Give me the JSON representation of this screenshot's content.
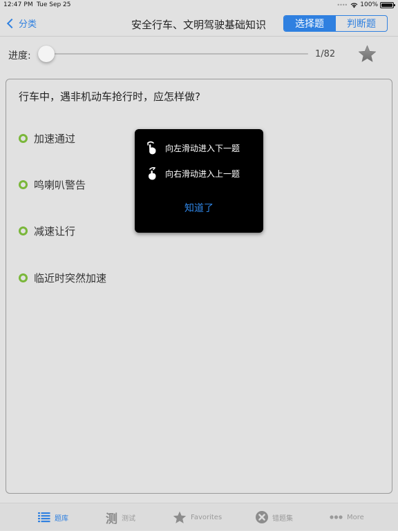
{
  "status_bar": {
    "time": "12:47 PM",
    "date": "Tue Sep 25",
    "battery": "100%",
    "wifi_icon": "wifi-icon",
    "battery_icon": "battery-icon"
  },
  "nav": {
    "back_label": "分类",
    "title": "安全行车、文明驾驶基础知识",
    "segments": [
      {
        "label": "选择题",
        "active": true
      },
      {
        "label": "判断题",
        "active": false
      }
    ],
    "accent": "#2f80e0"
  },
  "progress": {
    "label": "进度:",
    "current": 1,
    "total": 82,
    "count_text": "1/82",
    "slider_fraction": 0.0,
    "favorite_icon": "star-icon"
  },
  "question": {
    "text": "行车中，遇非机动车抢行时，应怎样做?",
    "options": [
      {
        "text": "加速通过"
      },
      {
        "text": "鸣喇叭警告"
      },
      {
        "text": "减速让行"
      },
      {
        "text": "临近时突然加速"
      }
    ],
    "radio_color": "#7ab73a"
  },
  "popup": {
    "hints": [
      {
        "icon": "swipe-left-hand-icon",
        "text": "向左滑动进入下一题"
      },
      {
        "icon": "swipe-right-hand-icon",
        "text": "向右滑动进入上一题"
      }
    ],
    "ok_label": "知道了"
  },
  "tab_bar": {
    "tabs": [
      {
        "label": "题库",
        "icon": "list-icon",
        "active": true
      },
      {
        "label": "测试",
        "icon": "test-icon",
        "active": false
      },
      {
        "label": "Favorites",
        "icon": "star-icon",
        "active": false
      },
      {
        "label": "错题集",
        "icon": "x-circle-icon",
        "active": false
      },
      {
        "label": "More",
        "icon": "more-icon",
        "active": false
      }
    ],
    "test_glyph": "测"
  }
}
